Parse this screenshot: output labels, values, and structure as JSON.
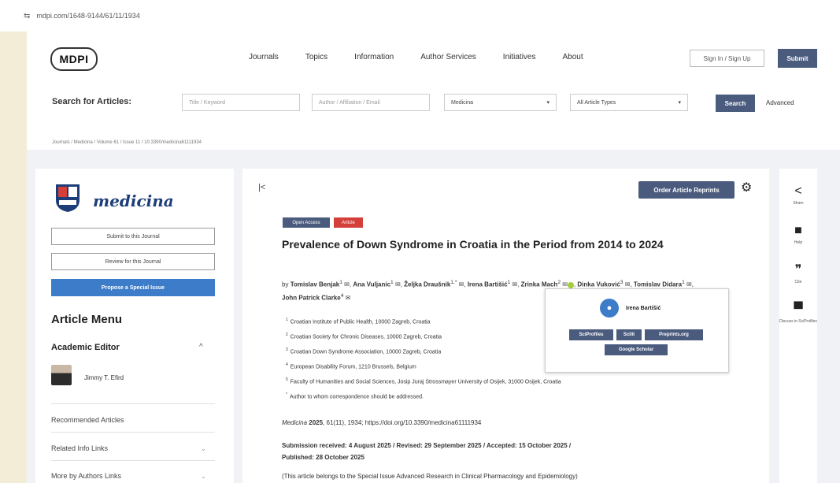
{
  "url": "mdpi.com/1648-9144/61/11/1934",
  "header": {
    "logo": "MDPI",
    "nav": [
      "Journals",
      "Topics",
      "Information",
      "Author Services",
      "Initiatives",
      "About"
    ],
    "signin": "Sign In / Sign Up",
    "submit": "Submit"
  },
  "search": {
    "label": "Search for Articles:",
    "title_placeholder": "Title / Keyword",
    "author_placeholder": "Author / Affiliation / Email",
    "journal_value": "Medicina",
    "type_value": "All Article Types",
    "search_button": "Search",
    "advanced": "Advanced"
  },
  "breadcrumb": "Journals / Medicina / Volume 61 / Issue 11 / 10.3390/medicina61111934",
  "sidebar": {
    "journal_name": "medicina",
    "submit_btn": "Submit to this Journal",
    "review_btn": "Review for this Journal",
    "propose_btn": "Propose a Special Issue",
    "article_menu": "Article Menu",
    "academic_editor": "Academic Editor",
    "editor_name": "Jimmy T. Efird",
    "links": [
      "Recommended Articles",
      "Related Info Links",
      "More by Authors Links"
    ]
  },
  "article": {
    "reprints": "Order Article Reprints",
    "badge_open": "Open Access",
    "badge_type": "Article",
    "title": "Prevalence of Down Syndrome in Croatia in the Period from 2014 to 2024",
    "authors_prefix": "by",
    "authors": [
      {
        "name": "Tomislav Benjak",
        "sup": "1"
      },
      {
        "name": "Ana Vuljanic",
        "sup": "1"
      },
      {
        "name": "Željka Draušnik",
        "sup": "1,*"
      },
      {
        "name": "Irena Bartišić",
        "sup": "1"
      },
      {
        "name": "Zrinka Mach",
        "sup": "2"
      },
      {
        "name": "Dinka Vuković",
        "sup": "3"
      },
      {
        "name": "Tomislav Didara",
        "sup": "1"
      },
      {
        "name": "John Patrick Clarke",
        "sup": "4"
      }
    ],
    "affiliations": [
      {
        "sup": "1",
        "text": "Croatian Institute of Public Health, 10000 Zagreb, Croatia"
      },
      {
        "sup": "2",
        "text": "Croatian Society for Chronic Diseases, 10000 Zagreb, Croatia"
      },
      {
        "sup": "3",
        "text": "Croatian Down Syndrome Association, 10000 Zagreb, Croatia"
      },
      {
        "sup": "4",
        "text": "European Disability Forum, 1210 Brussels, Belgium"
      },
      {
        "sup": "5",
        "text": "Faculty of Humanities and Social Sciences, Josip Juraj Strossmayer University of Osijek, 31000 Osijek, Croatia"
      },
      {
        "sup": "*",
        "text": "Author to whom correspondence should be addressed."
      }
    ],
    "citation_journal": "Medicina",
    "citation_year": "2025",
    "citation_rest": ", 61(11), 1934; https://doi.org/10.3390/medicina61111934",
    "dates_line1": "Submission received: 4 August 2025 / Revised: 29 September 2025 / Accepted: 15 October 2025 /",
    "dates_line2": "Published: 28 October 2025",
    "special_issue": "(This article belongs to the Special Issue Advanced Research in Clinical Pharmacology and Epidemiology)"
  },
  "popup": {
    "name": "Irena Bartišić",
    "btn_sciprofiles": "SciProfiles",
    "btn_scilit": "Scilit",
    "btn_preprints": "Preprints.org",
    "btn_scholar": "Google Scholar"
  },
  "right_sidebar": {
    "share": "Share",
    "help": "Help",
    "cite": "Cite",
    "discuss": "Discuss in SciProfiles"
  }
}
